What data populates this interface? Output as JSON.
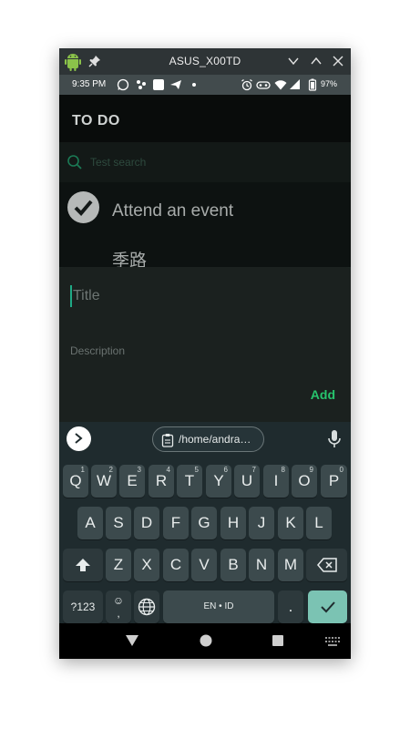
{
  "window": {
    "title": "ASUS_X00TD",
    "icons": [
      "android-icon",
      "pin-icon",
      "chevron-down-icon",
      "chevron-up-icon",
      "close-icon"
    ]
  },
  "status_bar": {
    "time": "9:35 PM",
    "battery": "97%",
    "icons": [
      "whatsapp-icon",
      "app-icon",
      "square-icon",
      "send-icon",
      "dot-icon",
      "alarm-icon",
      "vowifi-icon",
      "wifi-icon",
      "signal-icon",
      "battery-icon"
    ]
  },
  "app": {
    "title": "TO DO",
    "search_placeholder": "Test search"
  },
  "todos": [
    {
      "title": "Attend an event",
      "done": true
    },
    {
      "title": "季路",
      "done": true
    }
  ],
  "sheet": {
    "title_placeholder": "Title",
    "description_placeholder": "Description",
    "add_label": "Add"
  },
  "keyboard": {
    "clipboard_text": "/home/andra…",
    "row1": [
      {
        "k": "Q",
        "h": "1"
      },
      {
        "k": "W",
        "h": "2"
      },
      {
        "k": "E",
        "h": "3"
      },
      {
        "k": "R",
        "h": "4"
      },
      {
        "k": "T",
        "h": "5"
      },
      {
        "k": "Y",
        "h": "6"
      },
      {
        "k": "U",
        "h": "7"
      },
      {
        "k": "I",
        "h": "8"
      },
      {
        "k": "O",
        "h": "9"
      },
      {
        "k": "P",
        "h": "0"
      }
    ],
    "row2": [
      "A",
      "S",
      "D",
      "F",
      "G",
      "H",
      "J",
      "K",
      "L"
    ],
    "row3": [
      "Z",
      "X",
      "C",
      "V",
      "B",
      "N",
      "M"
    ],
    "symbols_label": "?123",
    "emoji_label": "☺",
    "comma_label": ",",
    "space_label": "EN • ID",
    "period_label": "."
  },
  "colors": {
    "accent": "#27c46d",
    "cursor": "#1fa985",
    "enter_key": "#7bc3b3"
  }
}
